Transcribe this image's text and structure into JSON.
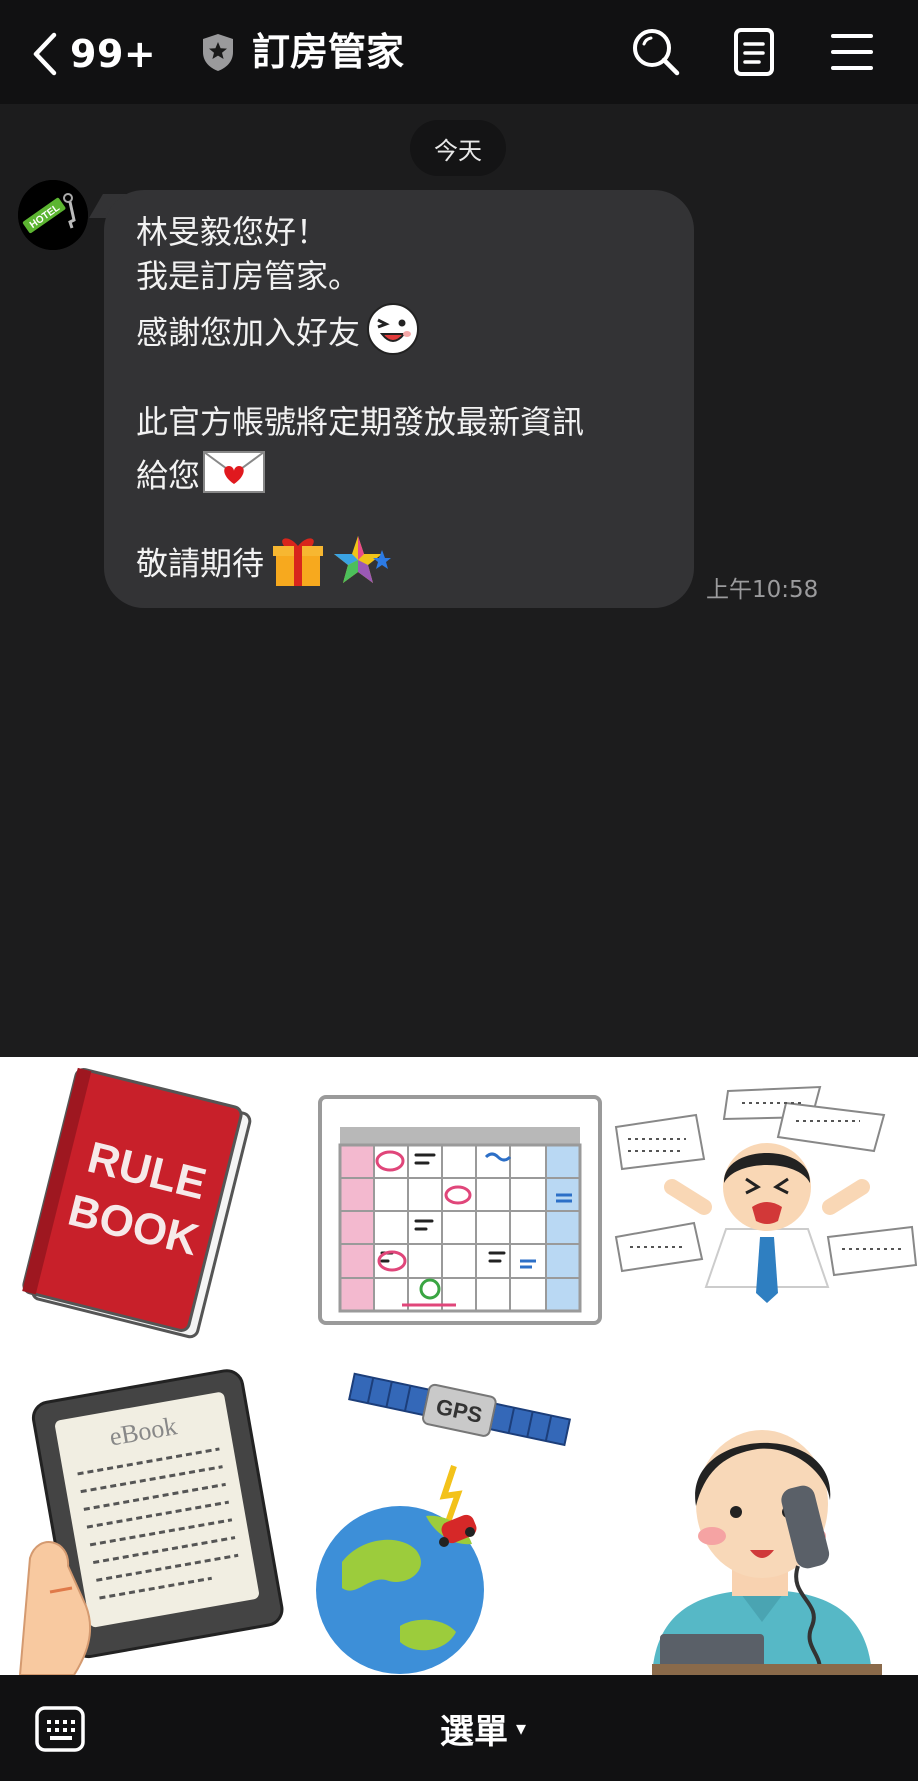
{
  "header": {
    "back_count": "99+",
    "title": "訂房管家",
    "icons": [
      "chevron-left-icon",
      "shield-star-icon",
      "search-icon",
      "notes-icon",
      "hamburger-menu-icon"
    ]
  },
  "chat": {
    "date_label": "今天",
    "avatar_text": "HOTEL",
    "message": {
      "line1": "林旻毅您好！",
      "line2": "我是訂房管家。",
      "line3": "感謝您加入好友",
      "line4": "此官方帳號將定期發放最新資訊",
      "line5": "給您",
      "line6": "敬請期待"
    },
    "emojis": [
      "winking-face-emoji",
      "love-letter-emoji",
      "gift-emoji",
      "shooting-star-emoji"
    ],
    "time": "上午10:58"
  },
  "rich_menu": {
    "items": [
      {
        "icon": "rule-book-icon",
        "book_text": "RULE\nBOOK"
      },
      {
        "icon": "calendar-icon"
      },
      {
        "icon": "stressed-worker-icon"
      },
      {
        "icon": "ebook-reader-icon",
        "screen_text": "eBook"
      },
      {
        "icon": "gps-satellite-icon",
        "satellite_text": "GPS"
      },
      {
        "icon": "phone-call-icon"
      }
    ]
  },
  "bottom_bar": {
    "menu_label": "選單",
    "caret": "▾"
  },
  "colors": {
    "header_bg": "#111112",
    "chat_bg": "#1c1c1d",
    "bubble_bg": "#333335",
    "rich_menu_bg": "#ffffff"
  }
}
